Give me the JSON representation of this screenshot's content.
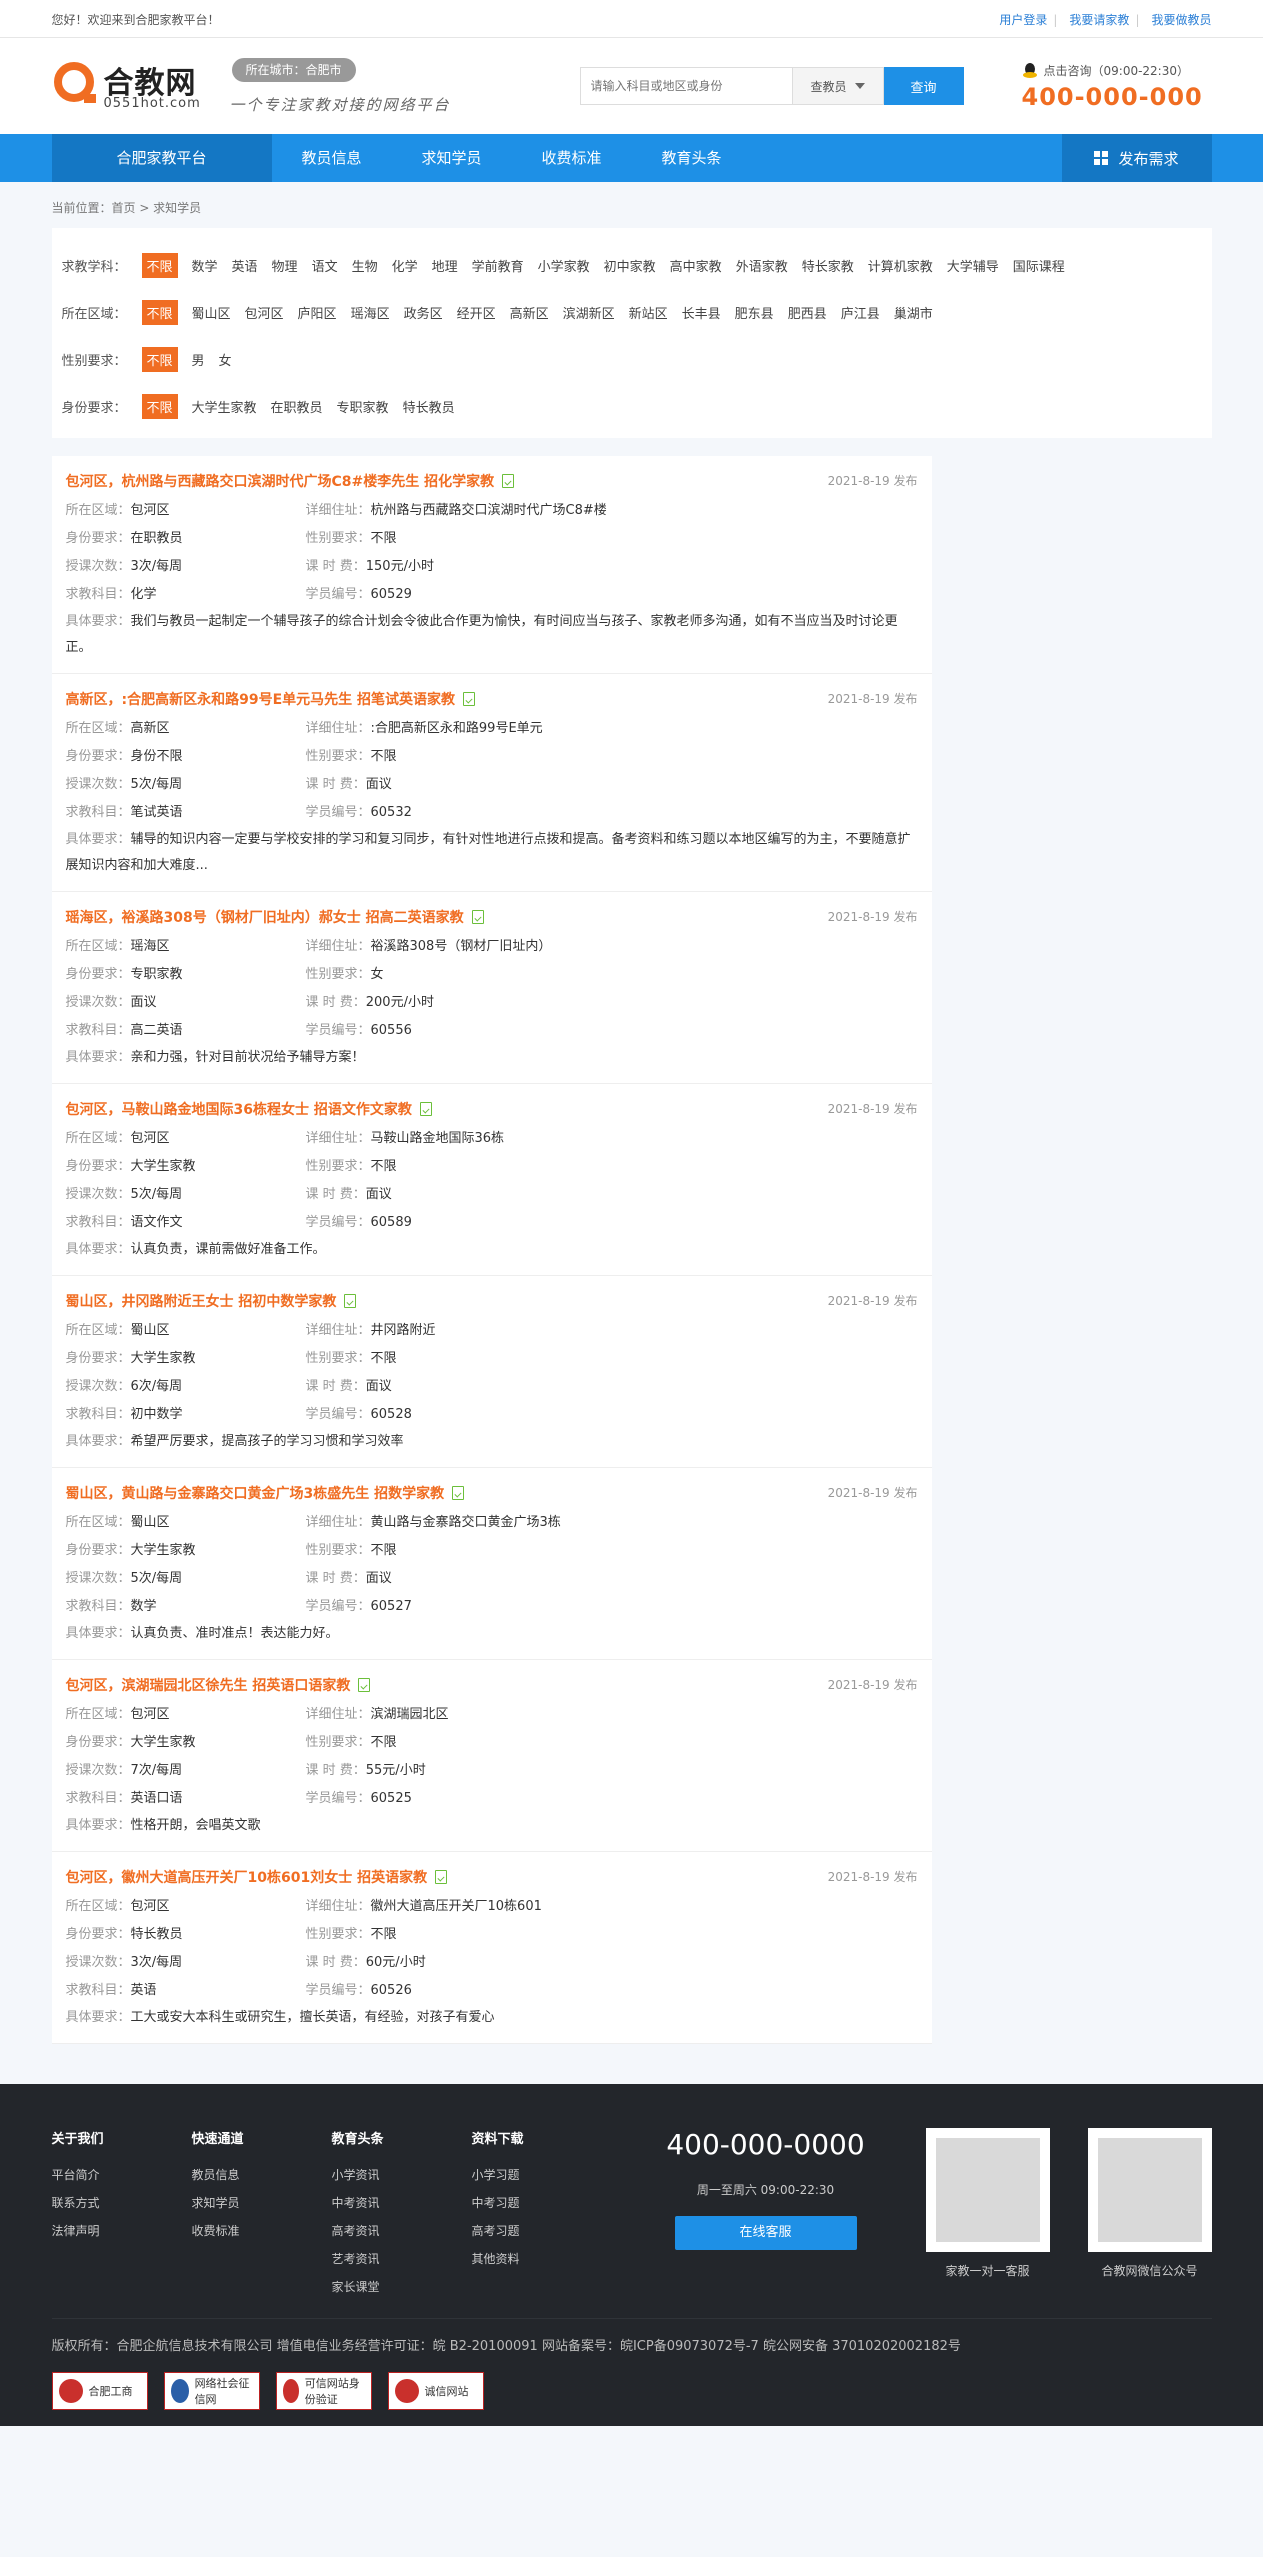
{
  "topbar": {
    "welcome": "您好！欢迎来到合肥家教平台！",
    "links": [
      "用户登录",
      "我要请家教",
      "我要做教员"
    ]
  },
  "header": {
    "logo_name": "合教网",
    "logo_domain": "0551hot.com",
    "city": "所在城市：合肥市",
    "slogan": "一个专注家教对接的网络平台",
    "search": {
      "placeholder": "请输入科目或地区或身份",
      "type": "查教员",
      "button": "查询"
    },
    "hotline": {
      "label": "点击咨询（09:00-22:30）",
      "number": "400-000-000"
    }
  },
  "nav": {
    "home": "合肥家教平台",
    "items": [
      "教员信息",
      "求知学员",
      "收费标准",
      "教育头条"
    ],
    "publish": "发布需求"
  },
  "breadcrumb": "当前位置：首页 > 求知学员",
  "filters": [
    {
      "label": "求教学科：",
      "options": [
        "不限",
        "数学",
        "英语",
        "物理",
        "语文",
        "生物",
        "化学",
        "地理",
        "学前教育",
        "小学家教",
        "初中家教",
        "高中家教",
        "外语家教",
        "特长家教",
        "计算机家教",
        "大学辅导",
        "国际课程"
      ]
    },
    {
      "label": "所在区域：",
      "options": [
        "不限",
        "蜀山区",
        "包河区",
        "庐阳区",
        "瑶海区",
        "政务区",
        "经开区",
        "高新区",
        "滨湖新区",
        "新站区",
        "长丰县",
        "肥东县",
        "肥西县",
        "庐江县",
        "巢湖市"
      ]
    },
    {
      "label": "性别要求：",
      "options": [
        "不限",
        "男",
        "女"
      ]
    },
    {
      "label": "身份要求：",
      "options": [
        "不限",
        "大学生家教",
        "在职教员",
        "专职家教",
        "特长教员"
      ]
    }
  ],
  "labels": {
    "area": "所在区域：",
    "addr": "详细住址：",
    "identity": "身份要求：",
    "gender": "性别要求：",
    "times": "授课次数：",
    "fee": "课 时 费：",
    "subject": "求教科目：",
    "code": "学员编号：",
    "req": "具体要求："
  },
  "jobs": [
    {
      "title": "包河区，杭州路与西藏路交口滨湖时代广场C8#楼李先生 招化学家教",
      "date": "2021-8-19 发布",
      "area": "包河区",
      "addr": "杭州路与西藏路交口滨湖时代广场C8#楼",
      "identity": "在职教员",
      "gender": "不限",
      "times": "3次/每周",
      "fee": "150元/小时",
      "subject": "化学",
      "code": "60529",
      "req": "我们与教员一起制定一个辅导孩子的综合计划会令彼此合作更为愉快，有时间应当与孩子、家教老师多沟通，如有不当应当及时讨论更正。"
    },
    {
      "title": "高新区，:合肥高新区永和路99号E单元马先生 招笔试英语家教",
      "date": "2021-8-19 发布",
      "area": "高新区",
      "addr": ":合肥高新区永和路99号E单元",
      "identity": "身份不限",
      "gender": "不限",
      "times": "5次/每周",
      "fee": "面议",
      "subject": "笔试英语",
      "code": "60532",
      "req": "辅导的知识内容一定要与学校安排的学习和复习同步，有针对性地进行点拨和提高。备考资料和练习题以本地区编写的为主，不要随意扩展知识内容和加大难度..."
    },
    {
      "title": "瑶海区，裕溪路308号（钢材厂旧址内）郝女士 招高二英语家教",
      "date": "2021-8-19 发布",
      "area": "瑶海区",
      "addr": "裕溪路308号（钢材厂旧址内）",
      "identity": "专职家教",
      "gender": "女",
      "times": "面议",
      "fee": "200元/小时",
      "subject": "高二英语",
      "code": "60556",
      "req": "亲和力强，针对目前状况给予辅导方案！"
    },
    {
      "title": "包河区，马鞍山路金地国际36栋程女士 招语文作文家教",
      "date": "2021-8-19 发布",
      "area": "包河区",
      "addr": "马鞍山路金地国际36栋",
      "identity": "大学生家教",
      "gender": "不限",
      "times": "5次/每周",
      "fee": "面议",
      "subject": "语文作文",
      "code": "60589",
      "req": "认真负责，课前需做好准备工作。"
    },
    {
      "title": "蜀山区，井冈路附近王女士 招初中数学家教",
      "date": "2021-8-19 发布",
      "area": "蜀山区",
      "addr": "井冈路附近",
      "identity": "大学生家教",
      "gender": "不限",
      "times": "6次/每周",
      "fee": "面议",
      "subject": "初中数学",
      "code": "60528",
      "req": "希望严厉要求，提高孩子的学习习惯和学习效率"
    },
    {
      "title": "蜀山区，黄山路与金寨路交口黄金广场3栋盛先生 招数学家教",
      "date": "2021-8-19 发布",
      "area": "蜀山区",
      "addr": "黄山路与金寨路交口黄金广场3栋",
      "identity": "大学生家教",
      "gender": "不限",
      "times": "5次/每周",
      "fee": "面议",
      "subject": "数学",
      "code": "60527",
      "req": "认真负责、准时准点！表达能力好。"
    },
    {
      "title": "包河区，滨湖瑞园北区徐先生 招英语口语家教",
      "date": "2021-8-19 发布",
      "area": "包河区",
      "addr": "滨湖瑞园北区",
      "identity": "大学生家教",
      "gender": "不限",
      "times": "7次/每周",
      "fee": "55元/小时",
      "subject": "英语口语",
      "code": "60525",
      "req": "性格开朗，会唱英文歌"
    },
    {
      "title": "包河区，徽州大道高压开关厂10栋601刘女士 招英语家教",
      "date": "2021-8-19 发布",
      "area": "包河区",
      "addr": "徽州大道高压开关厂10栋601",
      "identity": "特长教员",
      "gender": "不限",
      "times": "3次/每周",
      "fee": "60元/小时",
      "subject": "英语",
      "code": "60526",
      "req": "工大或安大本科生或研究生，擅长英语，有经验，对孩子有爱心"
    }
  ],
  "footer": {
    "cols": [
      {
        "title": "关于我们",
        "items": [
          "平台简介",
          "联系方式",
          "法律声明"
        ]
      },
      {
        "title": "快速通道",
        "items": [
          "教员信息",
          "求知学员",
          "收费标准"
        ]
      },
      {
        "title": "教育头条",
        "items": [
          "小学资讯",
          "中考资讯",
          "高考资讯",
          "艺考资讯",
          "家长课堂"
        ]
      },
      {
        "title": "资料下载",
        "items": [
          "小学习题",
          "中考习题",
          "高考习题",
          "其他资料"
        ]
      }
    ],
    "phone": "400-000-0000",
    "hours": "周一至周六 09:00-22:30",
    "service_button": "在线客服",
    "qr1": "家教一对一客服",
    "qr2": "合教网微信公众号",
    "copyright": "版权所有：合肥企航信息技术有限公司 增值电信业务经营许可证：皖 B2-20100091 网站备案号：皖ICP备09073072号-7  皖公网安备 37010202002182号",
    "badges": [
      "合肥工商",
      "网络社会征信网",
      "可信网站身份验证",
      "诚信网站"
    ]
  }
}
